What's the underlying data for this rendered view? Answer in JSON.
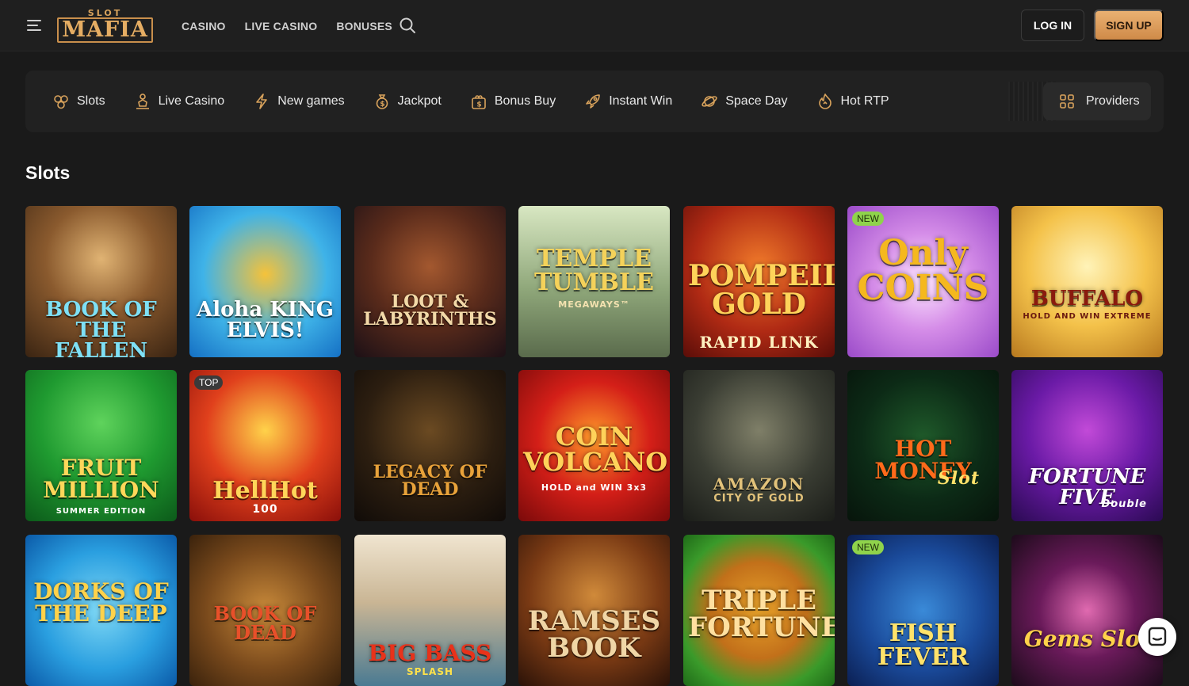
{
  "header": {
    "logo_small": "SLOT",
    "logo_big": "MAFIA",
    "nav": [
      "CASINO",
      "LIVE CASINO",
      "BONUSES"
    ],
    "login": "LOG IN",
    "signup": "SIGN UP"
  },
  "categories": [
    {
      "label": "Slots",
      "icon": "cherries-icon"
    },
    {
      "label": "Live Casino",
      "icon": "dealer-icon"
    },
    {
      "label": "New games",
      "icon": "lightning-icon"
    },
    {
      "label": "Jackpot",
      "icon": "money-bag-icon"
    },
    {
      "label": "Bonus Buy",
      "icon": "gift-bag-icon"
    },
    {
      "label": "Instant Win",
      "icon": "rocket-icon"
    },
    {
      "label": "Space Day",
      "icon": "planet-icon"
    },
    {
      "label": "Hot RTP",
      "icon": "flame-icon"
    }
  ],
  "providers_label": "Providers",
  "section_title": "Slots",
  "games": [
    {
      "title": "BOOK OF THE FALLEN",
      "badge": ""
    },
    {
      "title": "Aloha KING ELVIS!",
      "badge": ""
    },
    {
      "title": "LOOT & LABYRINTHS",
      "badge": ""
    },
    {
      "title": "TEMPLE TUMBLE",
      "subtitle": "MEGAWAYS™",
      "badge": ""
    },
    {
      "title": "POMPEII GOLD",
      "subtitle": "RAPID LINK",
      "badge": ""
    },
    {
      "title": "Only COINS",
      "badge": "NEW"
    },
    {
      "title": "BUFFALO",
      "subtitle": "HOLD AND WIN EXTREME",
      "badge": ""
    },
    {
      "title": "FRUIT MILLION",
      "subtitle": "SUMMER EDITION",
      "badge": ""
    },
    {
      "title": "HellHot",
      "subtitle": "100",
      "badge": "TOP"
    },
    {
      "title": "LEGACY OF DEAD",
      "badge": ""
    },
    {
      "title": "COIN VOLCANO",
      "subtitle": "HOLD and WIN 3x3",
      "badge": ""
    },
    {
      "title": "AMAZON",
      "subtitle": "CITY OF GOLD",
      "badge": ""
    },
    {
      "title": "HOT MONEY",
      "subtitle": "Slot",
      "badge": ""
    },
    {
      "title": "FORTUNE FIVE",
      "subtitle": "Double",
      "badge": ""
    },
    {
      "title": "DORKS OF THE DEEP",
      "badge": ""
    },
    {
      "title": "BOOK OF DEAD",
      "badge": ""
    },
    {
      "title": "BIG BASS",
      "subtitle": "SPLASH",
      "badge": ""
    },
    {
      "title": "RAMSES BOOK",
      "badge": ""
    },
    {
      "title": "TRIPLE FORTUNE",
      "badge": ""
    },
    {
      "title": "FISH FEVER",
      "badge": "NEW"
    },
    {
      "title": "Gems Slot",
      "badge": ""
    }
  ]
}
